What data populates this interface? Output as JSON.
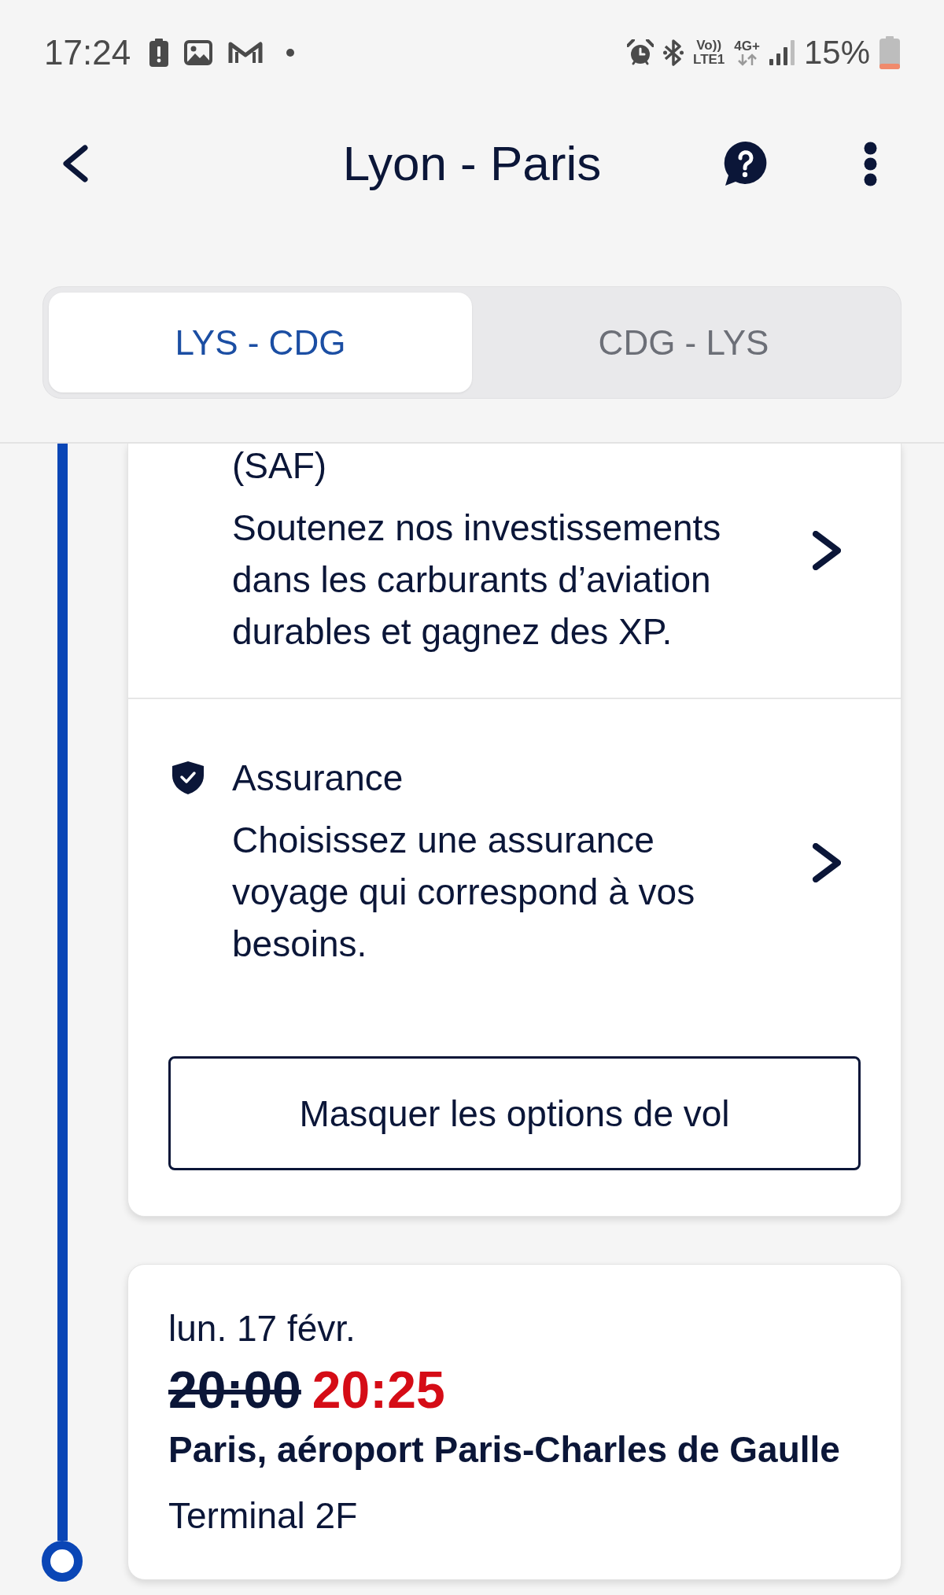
{
  "status_bar": {
    "time": "17:24",
    "volte": [
      "Vo))",
      "LTE1"
    ],
    "network": "4G+",
    "battery": "15%"
  },
  "header": {
    "title": "Lyon - Paris"
  },
  "tabs": [
    {
      "label": "LYS - CDG",
      "selected": true
    },
    {
      "label": "CDG - LYS",
      "selected": false
    }
  ],
  "options_card": {
    "options": [
      {
        "kind": "plain",
        "title": "(SAF)",
        "description": "Soutenez nos investissements dans les carburants d’aviation durables et gagnez des XP."
      },
      {
        "kind": "shield",
        "title": "Assurance",
        "description": "Choisissez une assurance voyage qui correspond à vos besoins."
      }
    ],
    "button": "Masquer les options de vol"
  },
  "arrival": {
    "date": "lun. 17 févr.",
    "times": [
      {
        "value": "20:00",
        "kind": "scheduled"
      },
      {
        "value": "20:25",
        "kind": "revised"
      }
    ],
    "airport": "Paris, aéroport Paris-Charles de Gaulle",
    "terminal": "Terminal 2F"
  }
}
